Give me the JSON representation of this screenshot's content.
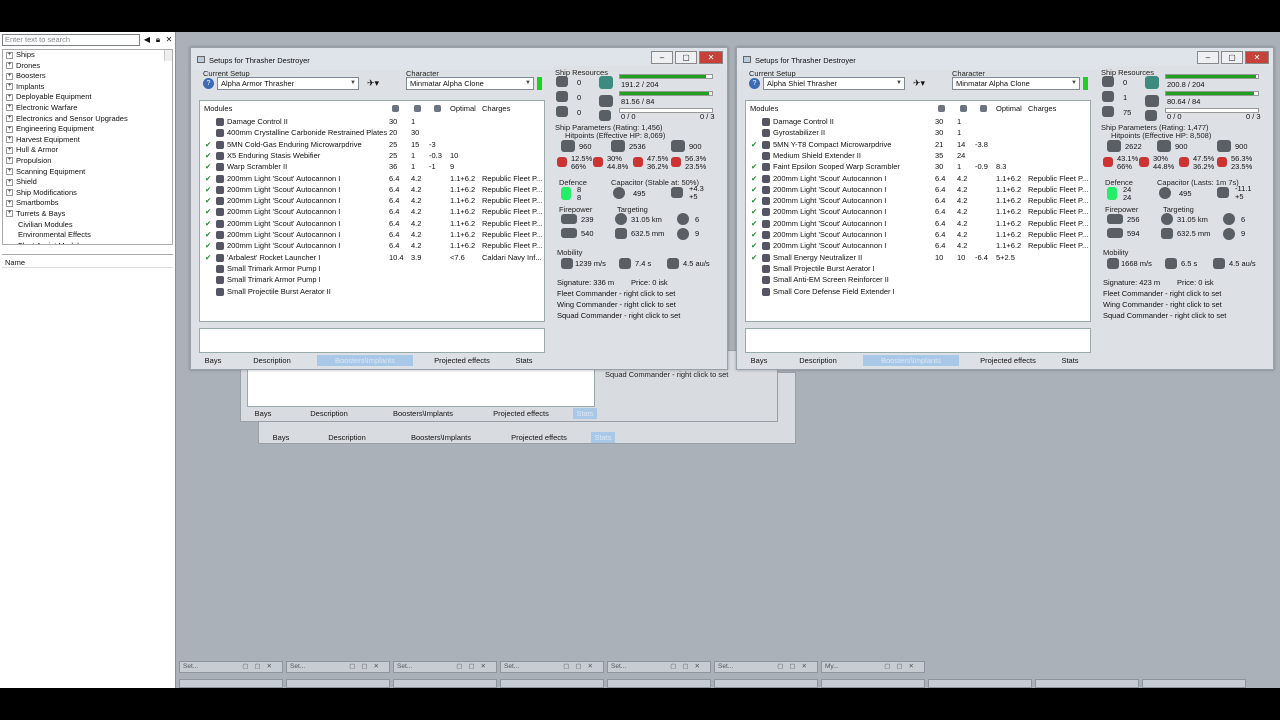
{
  "left_panel": {
    "search_placeholder": "Enter text to search",
    "tree": [
      "Ships",
      "Drones",
      "Boosters",
      "Implants",
      "Deployable Equipment",
      "Electronic Warfare",
      "Electronics and Sensor Upgrades",
      "Engineering Equipment",
      "Harvest Equipment",
      "Hull & Armor",
      "Propulsion",
      "Scanning Equipment",
      "Shield",
      "Ship Modifications",
      "Smartbombs",
      "Turrets & Bays",
      "Civilian Modules",
      "Environmental Effects",
      "Fleet Assist Modules"
    ],
    "name_header": "Name"
  },
  "windows": [
    {
      "title": "Setups for Thrasher Destroyer",
      "current_setup_label": "Current Setup",
      "current_setup": "Alpha Armor Thrasher",
      "character_label": "Character",
      "character": "Minmatar Alpha Clone",
      "headers": {
        "modules": "Modules",
        "optimal": "Optimal",
        "charges": "Charges"
      },
      "modules": [
        {
          "name": "Damage Control II",
          "check": "",
          "a": "30",
          "b": "1",
          "c": "",
          "opt": "",
          "chg": ""
        },
        {
          "name": "400mm Crystalline Carbonide Restrained Plates",
          "check": "",
          "a": "20",
          "b": "30",
          "c": "",
          "opt": "",
          "chg": ""
        },
        {
          "name": "5MN Cold-Gas Enduring Microwarpdrive",
          "check": "✔",
          "a": "25",
          "b": "15",
          "c": "-3",
          "opt": "",
          "chg": ""
        },
        {
          "name": "X5 Enduring Stasis Webifier",
          "check": "✔",
          "a": "25",
          "b": "1",
          "c": "-0.3",
          "opt": "10",
          "chg": ""
        },
        {
          "name": "Warp Scrambler II",
          "check": "✔",
          "a": "36",
          "b": "1",
          "c": "-1",
          "opt": "9",
          "chg": ""
        },
        {
          "name": "200mm Light 'Scout' Autocannon I",
          "check": "✔",
          "a": "6.4",
          "b": "4.2",
          "c": "",
          "opt": "1.1+6.2",
          "chg": "Republic Fleet P..."
        },
        {
          "name": "200mm Light 'Scout' Autocannon I",
          "check": "✔",
          "a": "6.4",
          "b": "4.2",
          "c": "",
          "opt": "1.1+6.2",
          "chg": "Republic Fleet P..."
        },
        {
          "name": "200mm Light 'Scout' Autocannon I",
          "check": "✔",
          "a": "6.4",
          "b": "4.2",
          "c": "",
          "opt": "1.1+6.2",
          "chg": "Republic Fleet P..."
        },
        {
          "name": "200mm Light 'Scout' Autocannon I",
          "check": "✔",
          "a": "6.4",
          "b": "4.2",
          "c": "",
          "opt": "1.1+6.2",
          "chg": "Republic Fleet P..."
        },
        {
          "name": "200mm Light 'Scout' Autocannon I",
          "check": "✔",
          "a": "6.4",
          "b": "4.2",
          "c": "",
          "opt": "1.1+6.2",
          "chg": "Republic Fleet P..."
        },
        {
          "name": "200mm Light 'Scout' Autocannon I",
          "check": "✔",
          "a": "6.4",
          "b": "4.2",
          "c": "",
          "opt": "1.1+6.2",
          "chg": "Republic Fleet P..."
        },
        {
          "name": "200mm Light 'Scout' Autocannon I",
          "check": "✔",
          "a": "6.4",
          "b": "4.2",
          "c": "",
          "opt": "1.1+6.2",
          "chg": "Republic Fleet P..."
        },
        {
          "name": "'Arbalest' Rocket Launcher I",
          "check": "✔",
          "a": "10.4",
          "b": "3.9",
          "c": "",
          "opt": "<7.6",
          "chg": "Caldari Navy Inf..."
        },
        {
          "name": "Small Trimark Armor Pump I",
          "check": "",
          "a": "",
          "b": "",
          "c": "",
          "opt": "",
          "chg": ""
        },
        {
          "name": "Small Trimark Armor Pump I",
          "check": "",
          "a": "",
          "b": "",
          "c": "",
          "opt": "",
          "chg": ""
        },
        {
          "name": "Small Projectile Burst Aerator II",
          "check": "",
          "a": "",
          "b": "",
          "c": "",
          "opt": "",
          "chg": ""
        }
      ],
      "tabs": [
        "Bays",
        "Description",
        "Boosters\\Implants",
        "Projected effects",
        "Stats"
      ],
      "resources": {
        "label": "Ship Resources",
        "r1": "0",
        "r2": "0",
        "r3": "0",
        "cpu": "191.2 / 204",
        "cpu_fill": 0.94,
        "pg": "81.56 / 84",
        "pg_fill": 0.97,
        "cal": "0 / 0",
        "slots": "0 / 3",
        "params": "Ship Parameters (Rating: 1,456)",
        "hp": "Hitpoints (Effective HP: 8,069)",
        "shield_hp": "960",
        "armor_hp": "2536",
        "hull_hp": "900",
        "res_sh": "12.5%",
        "res_sh2": "66%",
        "res_ar": "30%",
        "res_ar2": "44.8%",
        "res_hu": "47.5%",
        "res_hu2": "36.2%",
        "res_x": "56.3%",
        "res_x2": "23.5%",
        "defence_label": "Defence",
        "def1": "8",
        "def2": "8",
        "cap_label": "Capacitor (Stable at: 50%)",
        "cap": "495",
        "cap2": "+4.3",
        "cap3": "+5",
        "fp_label": "Firepower",
        "fp1": "239",
        "fp2": "540",
        "tgt_label": "Targeting",
        "tgt1": "31.05 km",
        "tgt2": "632.5 mm",
        "tgt3": "6",
        "tgt4": "9",
        "mob_label": "Mobility",
        "speed": "1239 m/s",
        "align": "7.4 s",
        "warp": "4.5 au/s",
        "sig": "Signature: 336 m",
        "price": "Price: 0 isk",
        "fleet": "Fleet Commander - right click to set",
        "wing": "Wing Commander - right click to set",
        "squad": "Squad Commander - right click to set"
      }
    },
    {
      "title": "Setups for Thrasher Destroyer",
      "current_setup_label": "Current Setup",
      "current_setup": "Alpha Shiel Thrasher",
      "character_label": "Character",
      "character": "Minmatar Alpha Clone",
      "headers": {
        "modules": "Modules",
        "optimal": "Optimal",
        "charges": "Charges"
      },
      "modules": [
        {
          "name": "Damage Control II",
          "check": "",
          "a": "30",
          "b": "1",
          "c": "",
          "opt": "",
          "chg": ""
        },
        {
          "name": "Gyrostabilizer II",
          "check": "",
          "a": "30",
          "b": "1",
          "c": "",
          "opt": "",
          "chg": ""
        },
        {
          "name": "5MN Y-T8 Compact Microwarpdrive",
          "check": "✔",
          "a": "21",
          "b": "14",
          "c": "-3.8",
          "opt": "",
          "chg": ""
        },
        {
          "name": "Medium Shield Extender II",
          "check": "",
          "a": "35",
          "b": "24",
          "c": "",
          "opt": "",
          "chg": ""
        },
        {
          "name": "Faint Epsilon Scoped Warp Scrambler",
          "check": "✔",
          "a": "30",
          "b": "1",
          "c": "-0.9",
          "opt": "8.3",
          "chg": ""
        },
        {
          "name": "200mm Light 'Scout' Autocannon I",
          "check": "✔",
          "a": "6.4",
          "b": "4.2",
          "c": "",
          "opt": "1.1+6.2",
          "chg": "Republic Fleet P..."
        },
        {
          "name": "200mm Light 'Scout' Autocannon I",
          "check": "✔",
          "a": "6.4",
          "b": "4.2",
          "c": "",
          "opt": "1.1+6.2",
          "chg": "Republic Fleet P..."
        },
        {
          "name": "200mm Light 'Scout' Autocannon I",
          "check": "✔",
          "a": "6.4",
          "b": "4.2",
          "c": "",
          "opt": "1.1+6.2",
          "chg": "Republic Fleet P..."
        },
        {
          "name": "200mm Light 'Scout' Autocannon I",
          "check": "✔",
          "a": "6.4",
          "b": "4.2",
          "c": "",
          "opt": "1.1+6.2",
          "chg": "Republic Fleet P..."
        },
        {
          "name": "200mm Light 'Scout' Autocannon I",
          "check": "✔",
          "a": "6.4",
          "b": "4.2",
          "c": "",
          "opt": "1.1+6.2",
          "chg": "Republic Fleet P..."
        },
        {
          "name": "200mm Light 'Scout' Autocannon I",
          "check": "✔",
          "a": "6.4",
          "b": "4.2",
          "c": "",
          "opt": "1.1+6.2",
          "chg": "Republic Fleet P..."
        },
        {
          "name": "200mm Light 'Scout' Autocannon I",
          "check": "✔",
          "a": "6.4",
          "b": "4.2",
          "c": "",
          "opt": "1.1+6.2",
          "chg": "Republic Fleet P..."
        },
        {
          "name": "Small Energy Neutralizer II",
          "check": "✔",
          "a": "10",
          "b": "10",
          "c": "-6.4",
          "opt": "5+2.5",
          "chg": ""
        },
        {
          "name": "Small Projectile Burst Aerator I",
          "check": "",
          "a": "",
          "b": "",
          "c": "",
          "opt": "",
          "chg": ""
        },
        {
          "name": "Small Anti-EM Screen Reinforcer II",
          "check": "",
          "a": "",
          "b": "",
          "c": "",
          "opt": "",
          "chg": ""
        },
        {
          "name": "Small Core Defense Field Extender I",
          "check": "",
          "a": "",
          "b": "",
          "c": "",
          "opt": "",
          "chg": ""
        }
      ],
      "tabs": [
        "Bays",
        "Description",
        "Boosters\\Implants",
        "Projected effects",
        "Stats"
      ],
      "resources": {
        "label": "Ship Resources",
        "r1": "0",
        "r2": "1",
        "r3": "75",
        "cpu": "200.8 / 204",
        "cpu_fill": 0.98,
        "pg": "80.64 / 84",
        "pg_fill": 0.96,
        "cal": "0 / 0",
        "slots": "0 / 3",
        "params": "Ship Parameters (Rating: 1,477)",
        "hp": "Hitpoints (Effective HP: 8,508)",
        "shield_hp": "2622",
        "armor_hp": "900",
        "hull_hp": "900",
        "res_sh": "43.1%",
        "res_sh2": "66%",
        "res_ar": "30%",
        "res_ar2": "44.8%",
        "res_hu": "47.5%",
        "res_hu2": "36.2%",
        "res_x": "56.3%",
        "res_x2": "23.5%",
        "defence_label": "Defence",
        "def1": "24",
        "def2": "24",
        "cap_label": "Capacitor (Lasts: 1m 7s)",
        "cap": "495",
        "cap2": "-11.1",
        "cap3": "+5",
        "fp_label": "Firepower",
        "fp1": "256",
        "fp2": "594",
        "tgt_label": "Targeting",
        "tgt1": "31.05 km",
        "tgt2": "632.5 mm",
        "tgt3": "6",
        "tgt4": "9",
        "mob_label": "Mobility",
        "speed": "1668 m/s",
        "align": "6.5 s",
        "warp": "4.5 au/s",
        "sig": "Signature: 423 m",
        "price": "Price: 0 isk",
        "fleet": "Fleet Commander - right click to set",
        "wing": "Wing Commander - right click to set",
        "squad": "Squad Commander - right click to set"
      }
    }
  ],
  "background_windows": {
    "tabs": [
      "Bays",
      "Description",
      "Boosters\\Implants",
      "Projected effects",
      "Stats"
    ],
    "squad_text": "Squad Commander - right click to set"
  },
  "taskbar": {
    "items": [
      "Set...",
      "Set...",
      "Set...",
      "Set...",
      "Set...",
      "Set...",
      "My..."
    ]
  }
}
